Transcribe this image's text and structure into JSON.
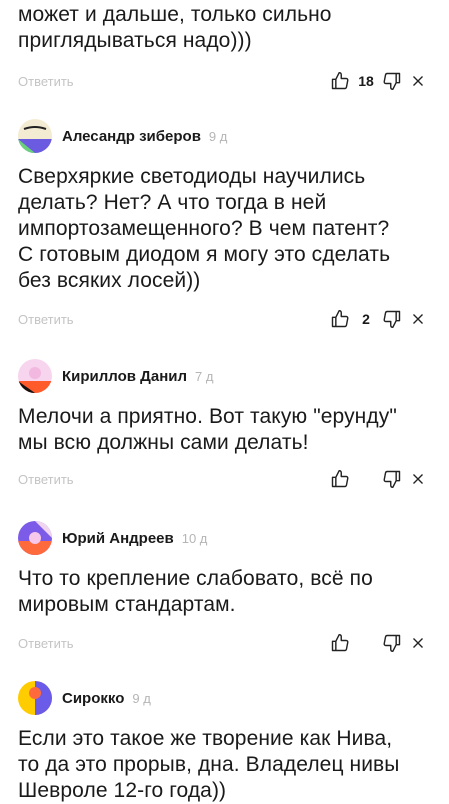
{
  "colors": {
    "text": "#1a1a1a",
    "muted": "#b5b5b5"
  },
  "partial_comment": {
    "lines": [
      "может и дальше, только сильно",
      "приглядываться надо)))"
    ],
    "reply": "Ответить",
    "likes": "18"
  },
  "comments": [
    {
      "author": "Алесандр зиберов",
      "time": "9 д",
      "lines": [
        "Сверхяркие светодиоды научились",
        "делать? Нет? А что тогда в ней",
        "импортозамещенного? В чем патент?",
        "С готовым диодом я могу это сделать",
        "без всяких лосей))"
      ],
      "reply": "Ответить",
      "likes": "2"
    },
    {
      "author": "Кириллов Данил",
      "time": "7 д",
      "lines": [
        "Мелочи а приятно. Вот такую \"ерунду\"",
        "мы всю должны сами делать!"
      ],
      "reply": "Ответить",
      "likes": ""
    },
    {
      "author": "Юрий Андреев",
      "time": "10 д",
      "lines": [
        "Что то крепление слабовато, всё по",
        "мировым стандартам."
      ],
      "reply": "Ответить",
      "likes": ""
    },
    {
      "author": "Сирокко",
      "time": "9 д",
      "lines": [
        "Если это такое же творение как Нива,",
        "то да это прорыв, дна. Владелец нивы",
        "Шевроле 12-го года))"
      ]
    }
  ]
}
